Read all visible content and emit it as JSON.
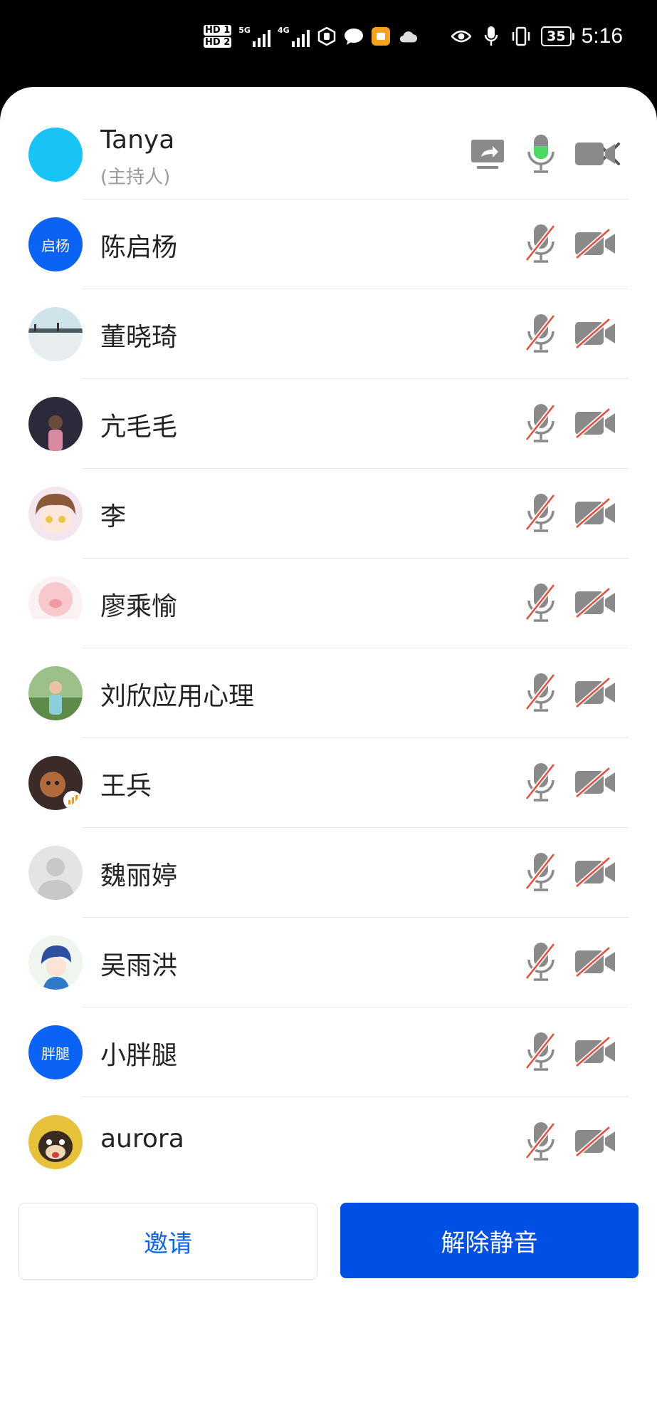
{
  "status_bar": {
    "time": "5:16",
    "battery": "35",
    "hd1": "HD 1",
    "hd2": "HD 2",
    "net1": "5G",
    "net2": "4G"
  },
  "sheet": {
    "close_icon": "close-icon"
  },
  "participants": [
    {
      "name": "Tanya",
      "role": "(主持人)",
      "avatar_color": "#18c4f5",
      "mic": "on",
      "cam": "on",
      "sharing": true
    },
    {
      "name": "陈启杨",
      "avatar_text": "启杨",
      "mic": "muted",
      "cam": "off"
    },
    {
      "name": "董晓琦",
      "mic": "muted",
      "cam": "off"
    },
    {
      "name": "亢毛毛",
      "mic": "muted",
      "cam": "off"
    },
    {
      "name": "李",
      "mic": "muted",
      "cam": "off"
    },
    {
      "name": "廖乘愉",
      "mic": "muted",
      "cam": "off"
    },
    {
      "name": "刘欣应用心理",
      "mic": "muted",
      "cam": "off"
    },
    {
      "name": "王兵",
      "mic": "muted",
      "cam": "off"
    },
    {
      "name": "魏丽婷",
      "mic": "muted",
      "cam": "off"
    },
    {
      "name": "吴雨洪",
      "mic": "muted",
      "cam": "off"
    },
    {
      "name": "小胖腿",
      "avatar_text": "胖腿",
      "mic": "muted",
      "cam": "off"
    },
    {
      "name": "aurora",
      "mic": "muted",
      "cam": "off"
    }
  ],
  "footer": {
    "invite_label": "邀请",
    "unmute_label": "解除静音"
  },
  "colors": {
    "accent": "#0050e6",
    "mic_active": "#4cd964",
    "muted_slash": "#e74c3c",
    "icon_gray": "#8a8a8a"
  }
}
